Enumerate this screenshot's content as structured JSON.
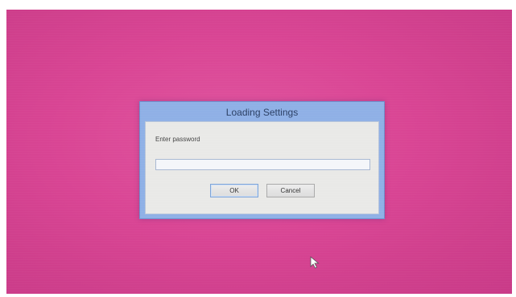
{
  "dialog": {
    "title": "Loading Settings",
    "prompt": "Enter password",
    "password_value": "",
    "ok_label": "OK",
    "cancel_label": "Cancel"
  },
  "icons": {
    "cursor": "mouse-pointer-icon"
  },
  "colors": {
    "desktop_background": "#d94594",
    "dialog_frame": "#8fb0e6",
    "dialog_body": "#e9e9e7"
  }
}
